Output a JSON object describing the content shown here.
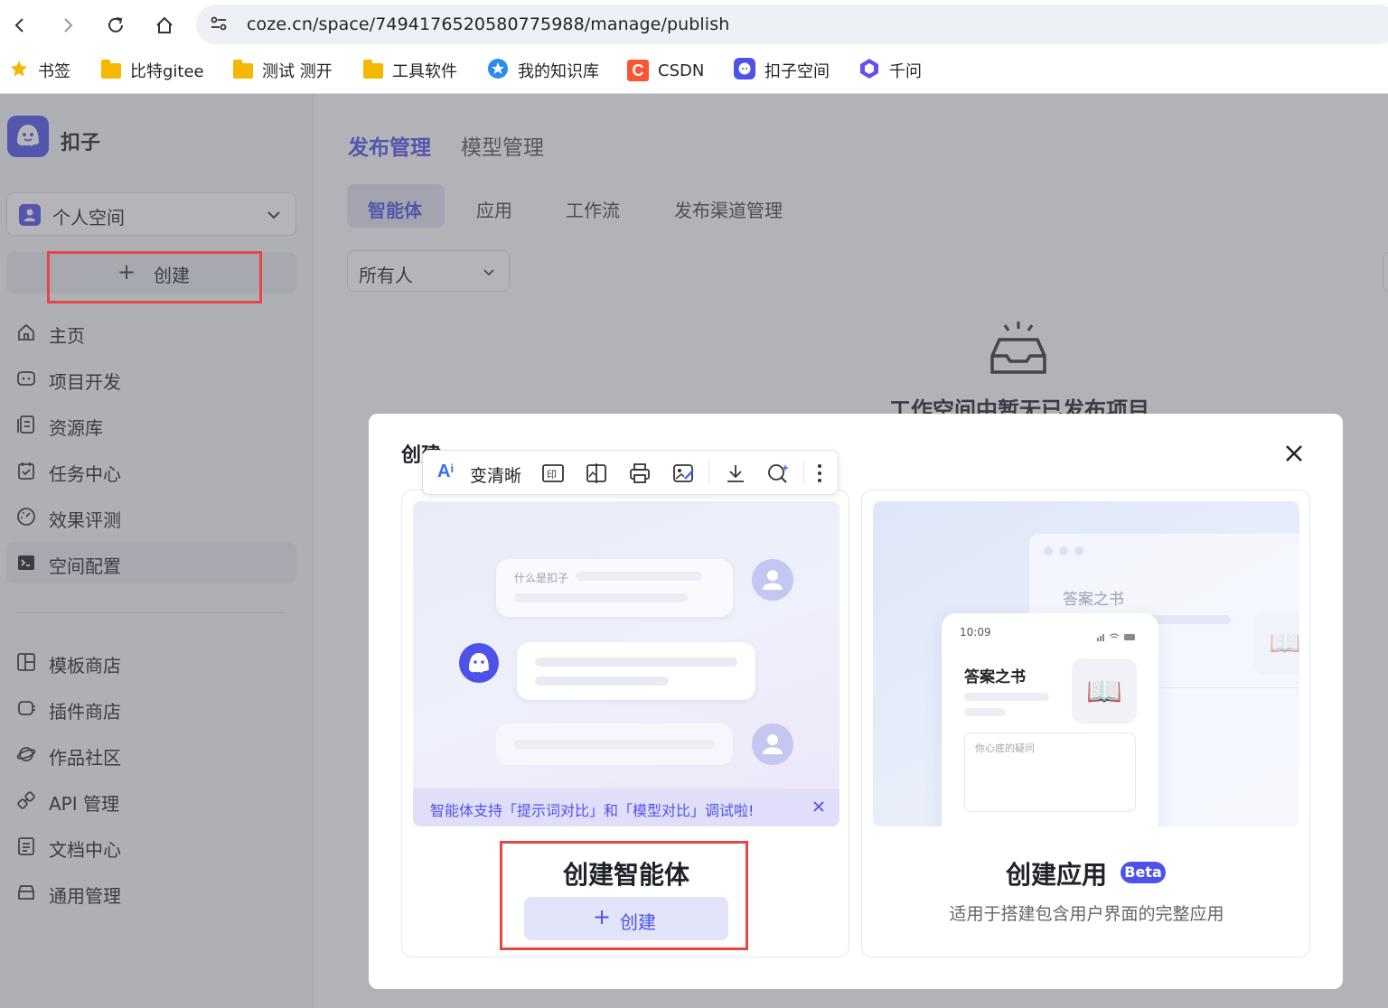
{
  "browser": {
    "url": "coze.cn/space/7494176520580775988/manage/publish",
    "bookmarks": [
      {
        "label": "书签",
        "icon": "star-icon"
      },
      {
        "label": "比特gitee",
        "icon": "folder-icon"
      },
      {
        "label": "测试 测开",
        "icon": "folder-icon"
      },
      {
        "label": "工具软件",
        "icon": "folder-icon"
      },
      {
        "label": "我的知识库",
        "icon": "knowledge-icon"
      },
      {
        "label": "CSDN",
        "icon": "csdn-icon"
      },
      {
        "label": "扣子空间",
        "icon": "coze-icon"
      },
      {
        "label": "千问",
        "icon": "qianwen-icon"
      }
    ]
  },
  "sidebar": {
    "brand": "扣子",
    "workspace": "个人空间",
    "create_label": "创建",
    "items": [
      {
        "label": "主页",
        "icon": "home-icon"
      },
      {
        "label": "项目开发",
        "icon": "project-icon"
      },
      {
        "label": "资源库",
        "icon": "library-icon"
      },
      {
        "label": "任务中心",
        "icon": "task-icon"
      },
      {
        "label": "效果评测",
        "icon": "evaluate-icon"
      },
      {
        "label": "空间配置",
        "icon": "config-icon"
      }
    ],
    "items2": [
      {
        "label": "模板商店",
        "icon": "template-icon"
      },
      {
        "label": "插件商店",
        "icon": "plugin-icon"
      },
      {
        "label": "作品社区",
        "icon": "community-icon"
      },
      {
        "label": "API 管理",
        "icon": "api-icon"
      },
      {
        "label": "文档中心",
        "icon": "doc-icon"
      },
      {
        "label": "通用管理",
        "icon": "manage-icon"
      }
    ]
  },
  "main": {
    "tabs": [
      "发布管理",
      "模型管理"
    ],
    "subtabs": [
      "智能体",
      "应用",
      "工作流",
      "发布渠道管理"
    ],
    "filter": "所有人",
    "empty_text": "工作空间中暂无已发布项目"
  },
  "modal": {
    "title": "创建",
    "toolbar": {
      "enhance_label": "变清晰"
    },
    "agent_card": {
      "chat_question": "什么是扣子",
      "banner": "智能体支持「提示词对比」和「模型对比」调试啦!",
      "title": "创建智能体",
      "button": "创建"
    },
    "app_card": {
      "book_title": "答案之书",
      "phone_time": "10:09",
      "phone_title": "答案之书",
      "phone_placeholder": "你心底的疑问",
      "title": "创建应用",
      "badge": "Beta",
      "desc": "适用于搭建包含用户界面的完整应用"
    }
  },
  "colors": {
    "accent": "#4d53e8",
    "highlight": "#e94545",
    "sidebar_bg": "#f5f6fa"
  }
}
